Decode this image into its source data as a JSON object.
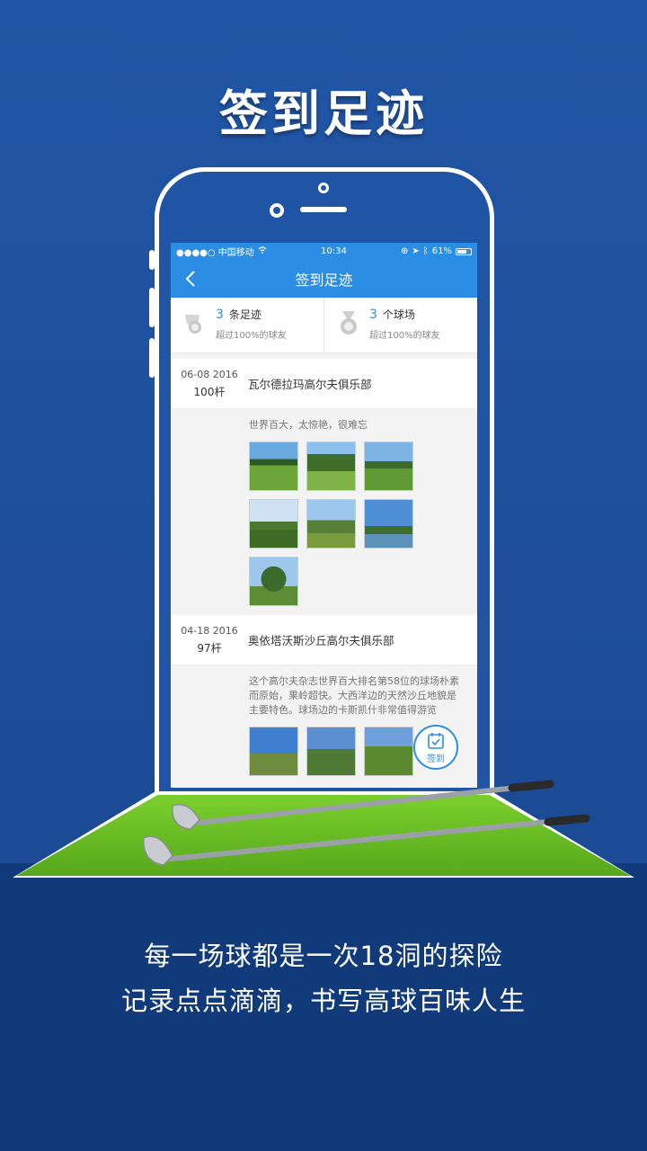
{
  "hero": {
    "title": "签到足迹"
  },
  "status_bar": {
    "carrier": "●●●●○ 中国移动",
    "time": "10:34",
    "battery": "61%"
  },
  "nav": {
    "title": "签到足迹"
  },
  "stats": [
    {
      "count": "3",
      "unit": "条足迹",
      "sub": "超过100%的球友",
      "icon": "footprint-trophy-icon"
    },
    {
      "count": "3",
      "unit": "个球场",
      "sub": "超过100%的球友",
      "icon": "medal-icon"
    }
  ],
  "entries": [
    {
      "date": "06-08 2016",
      "score": "100杆",
      "course": "瓦尔德拉玛高尔夫俱乐部",
      "desc": "世界百大，太惊艳，很难忘"
    },
    {
      "date": "04-18 2016",
      "score": "97杆",
      "course": "奥依塔沃斯沙丘高尔夫俱乐部",
      "desc": "这个高尔夫杂志世界百大排名第58位的球场朴素而原始，果岭超快。大西洋边的天然沙丘地貌是主要特色。球场边的卡斯凯什非常值得游览"
    }
  ],
  "checkin": {
    "label": "签到"
  },
  "taglines": {
    "line1": "每一场球都是一次18洞的探险",
    "line2": "记录点点滴滴，书写高球百味人生"
  },
  "colors": {
    "accent": "#2b8de3",
    "background": "#1e4f9c",
    "bottom": "#113a7a"
  }
}
